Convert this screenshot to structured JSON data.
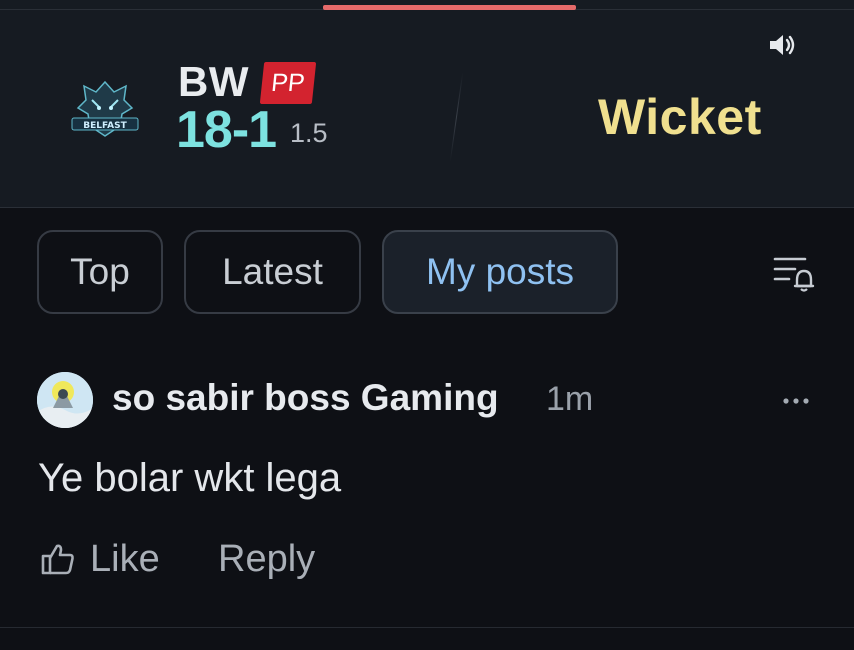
{
  "scoreboard": {
    "progress_color": "#e56a6a",
    "team": "BW",
    "powerplay_badge": "PP",
    "score": "18-1",
    "overs": "1.5",
    "event": "Wicket",
    "icons": {
      "team_logo": "belfast-wolf-logo",
      "logo_text": "BELFAST",
      "sound": "speaker-icon"
    }
  },
  "tabs": [
    {
      "label": "Top",
      "active": false
    },
    {
      "label": "Latest",
      "active": false
    },
    {
      "label": "My posts",
      "active": true
    }
  ],
  "filter": {
    "icon": "filter-bell-icon"
  },
  "post": {
    "author": "so sabir boss Gaming",
    "time": "1m",
    "text": "Ye bolar wkt lega",
    "actions": {
      "like": "Like",
      "reply": "Reply"
    },
    "icons": {
      "avatar": "avatar-image",
      "more": "more-options-icon",
      "like": "thumbs-up-icon"
    }
  },
  "colors": {
    "background": "#0e1015",
    "header_background": "#161b22",
    "score": "#7de2e0",
    "event": "#f0e08f",
    "active_tab_text": "#8fc1f1",
    "badge": "#d3232f"
  }
}
